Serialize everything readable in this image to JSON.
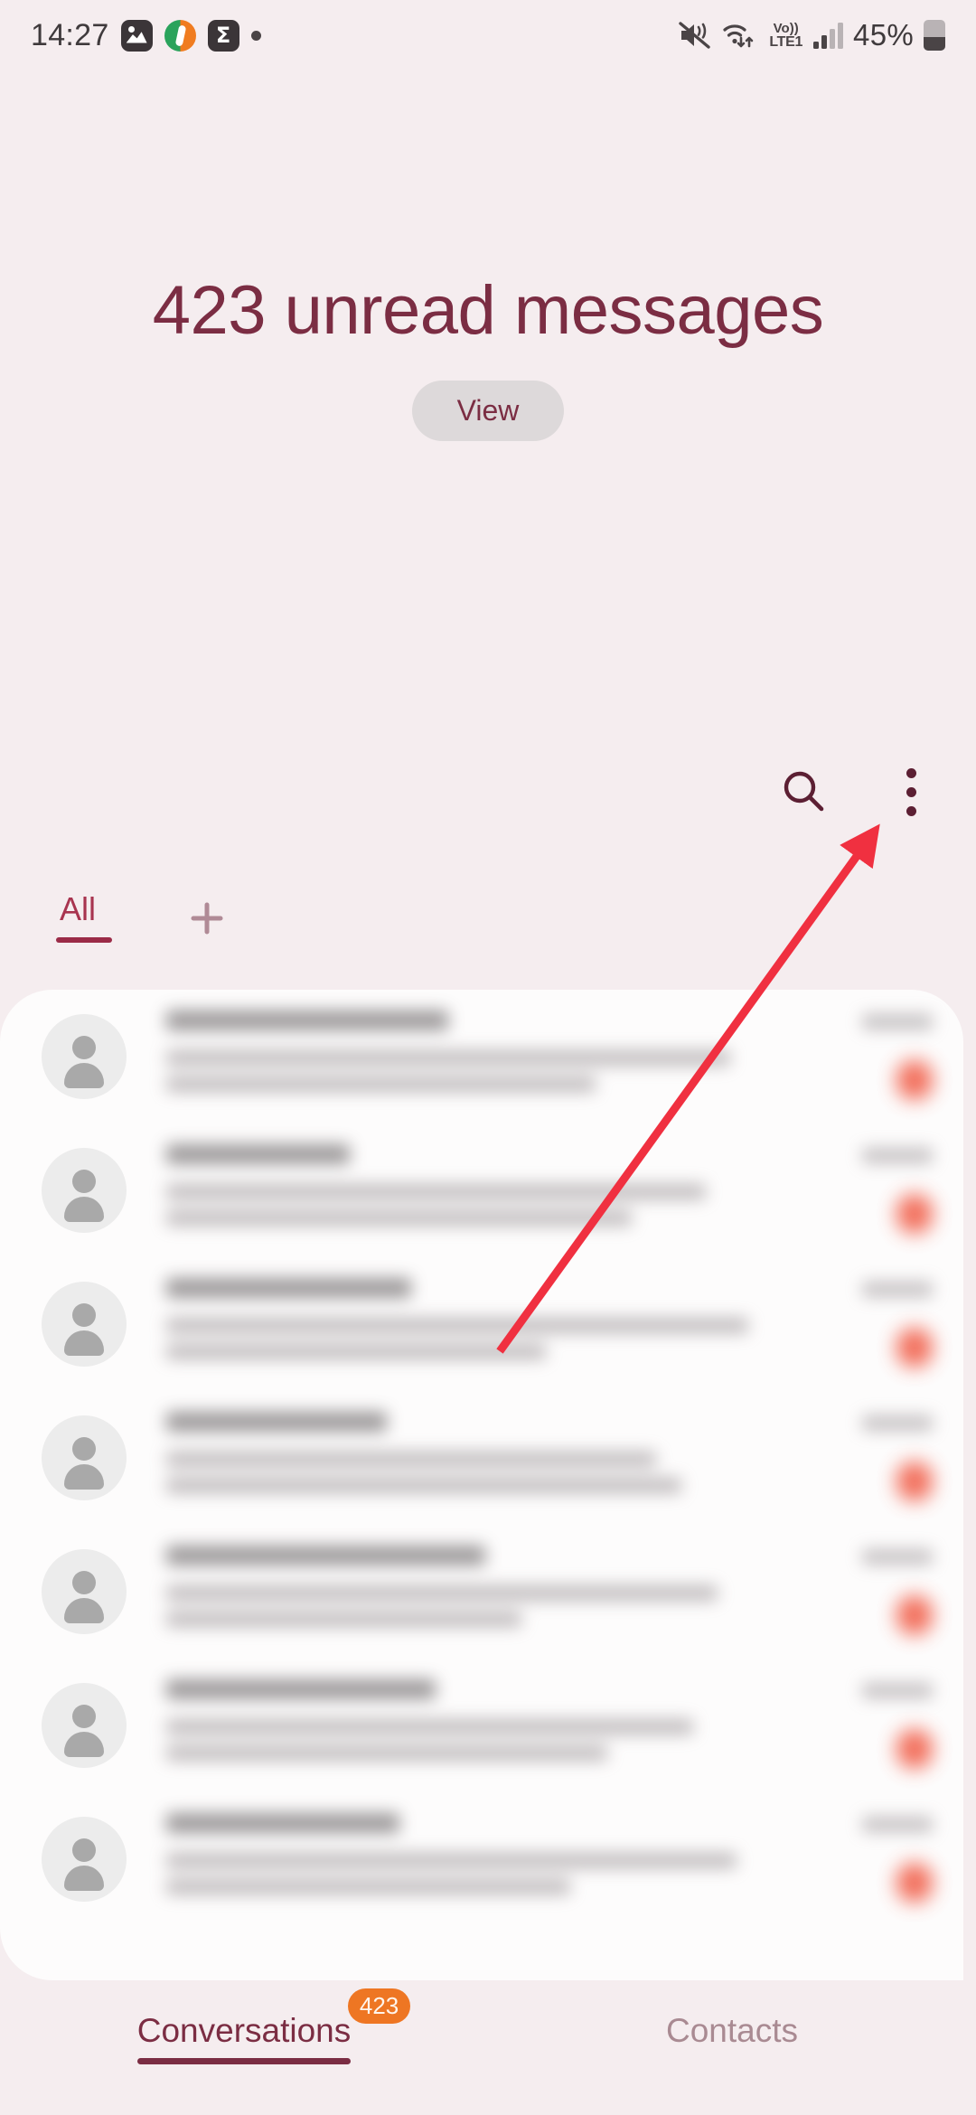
{
  "status_bar": {
    "time": "14:27",
    "left_icons": [
      "gallery-icon",
      "app-round-icon",
      "sigma-app-icon",
      "notification-dot-icon"
    ],
    "right_icons": [
      "mute-icon",
      "wifi-data-icon",
      "volte-icon",
      "signal-bars-icon"
    ],
    "volte_top": "Vo))",
    "volte_bottom": "LTE1",
    "battery_percent": "45%"
  },
  "header": {
    "title": "423 unread messages",
    "view_label": "View"
  },
  "actions": {
    "search_icon": "search-icon",
    "more_icon": "more-options-icon"
  },
  "tabs": {
    "all_label": "All",
    "add_label": "+"
  },
  "conversations": [
    {
      "name": "",
      "preview": "",
      "time": "",
      "unread": ""
    },
    {
      "name": "",
      "preview": "",
      "time": "",
      "unread": ""
    },
    {
      "name": "",
      "preview": "",
      "time": "",
      "unread": ""
    },
    {
      "name": "",
      "preview": "",
      "time": "",
      "unread": ""
    },
    {
      "name": "",
      "preview": "",
      "time": "",
      "unread": ""
    },
    {
      "name": "",
      "preview": "",
      "time": "",
      "unread": ""
    },
    {
      "name": "",
      "preview": "",
      "time": "",
      "unread": ""
    }
  ],
  "bottom_nav": {
    "conversations_label": "Conversations",
    "conversations_badge": "423",
    "contacts_label": "Contacts"
  },
  "annotation": {
    "type": "arrow",
    "points_to": "more-options-icon",
    "color": "#F03040"
  },
  "colors": {
    "background": "#F5EDEF",
    "card": "#FDFCFC",
    "accent_maroon": "#7B2D43",
    "accent_dark": "#5C1F33",
    "tab_active": "#A8344F",
    "muted_mauve": "#A98A92",
    "badge_orange": "#EE7623",
    "unread_red": "#F0533C",
    "annotation_red": "#F03040"
  }
}
